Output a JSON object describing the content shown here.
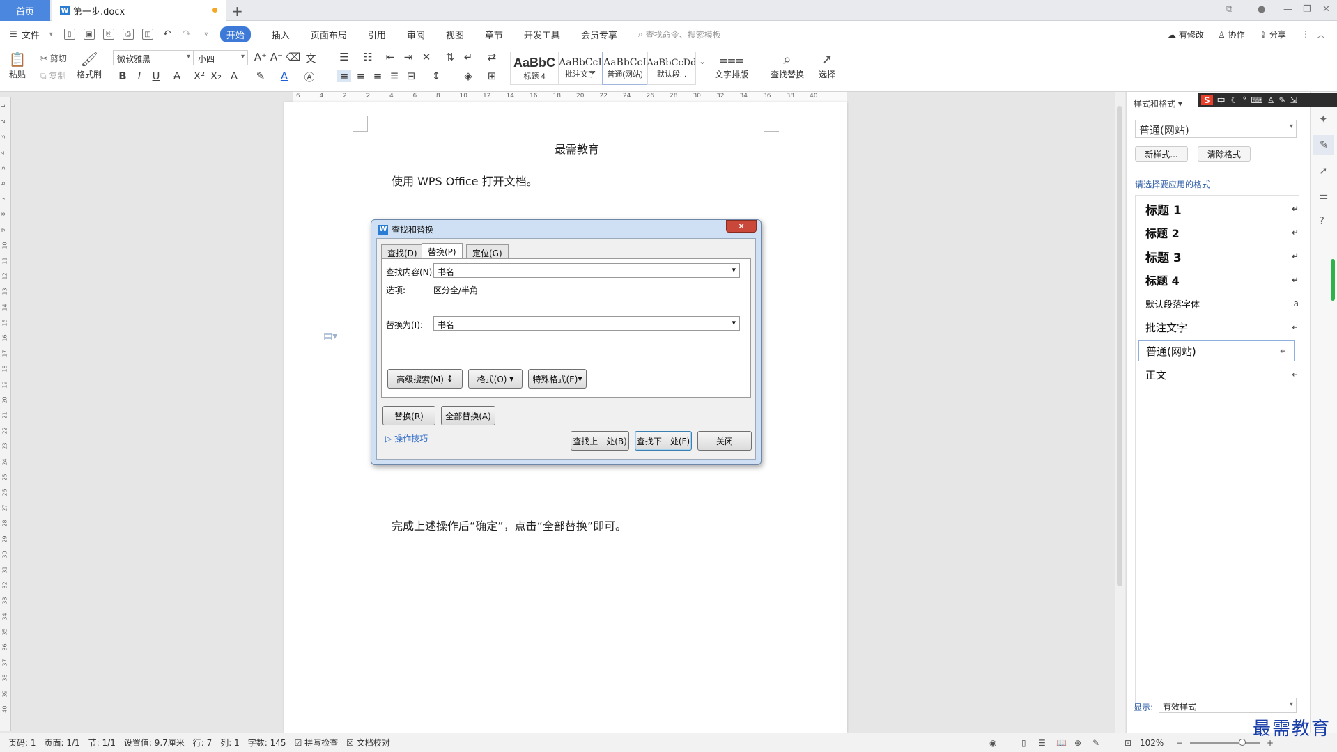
{
  "tabs": {
    "home": "首页",
    "document": "第一步.docx"
  },
  "menu": {
    "file": "文件",
    "items": [
      "开始",
      "插入",
      "页面布局",
      "引用",
      "审阅",
      "视图",
      "章节",
      "开发工具",
      "会员专享"
    ],
    "search_placeholder": "查找命令、搜索模板",
    "right": [
      "有修改",
      "协作",
      "分享"
    ]
  },
  "ribbon": {
    "paste": "粘贴",
    "cut": "剪切",
    "copy": "复制",
    "format_painter": "格式刷",
    "font_name": "微软雅黑",
    "font_size": "小四",
    "styles": [
      {
        "sample": "AaBbC",
        "name": "标题 4"
      },
      {
        "sample": "AaBbCcI",
        "name": "批注文字"
      },
      {
        "sample": "AaBbCcI",
        "name": "普通(网站)"
      },
      {
        "sample": "AaBbCcDd",
        "name": "默认段..."
      }
    ],
    "text_layout": "文字排版",
    "find_replace": "查找替换",
    "select": "选择"
  },
  "ruler_ticks": [
    "6",
    "4",
    "2",
    "2",
    "4",
    "6",
    "8",
    "10",
    "12",
    "14",
    "16",
    "18",
    "20",
    "22",
    "24",
    "26",
    "28",
    "30",
    "32",
    "34",
    "36",
    "38",
    "40"
  ],
  "vruler_ticks": [
    "1",
    "2",
    "3",
    "4",
    "5",
    "6",
    "7",
    "8",
    "9",
    "10",
    "11",
    "12",
    "13",
    "14",
    "15",
    "16",
    "17",
    "18",
    "19",
    "20",
    "21",
    "22",
    "23",
    "24",
    "25",
    "26",
    "27",
    "28",
    "29",
    "30",
    "31",
    "32",
    "33",
    "34",
    "35",
    "36",
    "37",
    "38",
    "39",
    "40"
  ],
  "document": {
    "header": "最需教育",
    "line1": "使用 WPS Office 打开文档。",
    "line2": "完成上述操作后“确定”，点击“全部替换”即可。"
  },
  "dialog": {
    "title": "查找和替换",
    "tabs": [
      "查找(D)",
      "替换(P)",
      "定位(G)"
    ],
    "find_label": "查找内容(N):",
    "find_value": "书名",
    "options_label": "选项:",
    "options_value": "区分全/半角",
    "replace_label": "替换为(I):",
    "replace_value": "书名",
    "advanced": "高级搜索(M)",
    "format": "格式(O)",
    "special": "特殊格式(E)",
    "replace_btn": "替换(R)",
    "replace_all_btn": "全部替换(A)",
    "tips": "操作技巧",
    "find_prev": "查找上一处(B)",
    "find_next": "查找下一处(F)",
    "close": "关闭"
  },
  "side_panel": {
    "header": "样式和格式",
    "current_style": "普通(网站)",
    "new_style": "新样式...",
    "clear_format": "清除格式",
    "prompt": "请选择要应用的格式",
    "styles": [
      "标题 1",
      "标题 2",
      "标题 3",
      "标题 4",
      "默认段落字体",
      "批注文字",
      "普通(网站)",
      "正文"
    ],
    "show_label": "显示:",
    "show_value": "有效样式"
  },
  "ime_bar": "中",
  "status": {
    "page": "页码: 1",
    "pages": "页面: 1/1",
    "section": "节: 1/1",
    "setting": "设置值: 9.7厘米",
    "row": "行: 7",
    "col": "列: 1",
    "words": "字数: 145",
    "spell": "拼写检查",
    "proof": "文档校对",
    "zoom": "102%"
  },
  "watermark": "最需教育"
}
